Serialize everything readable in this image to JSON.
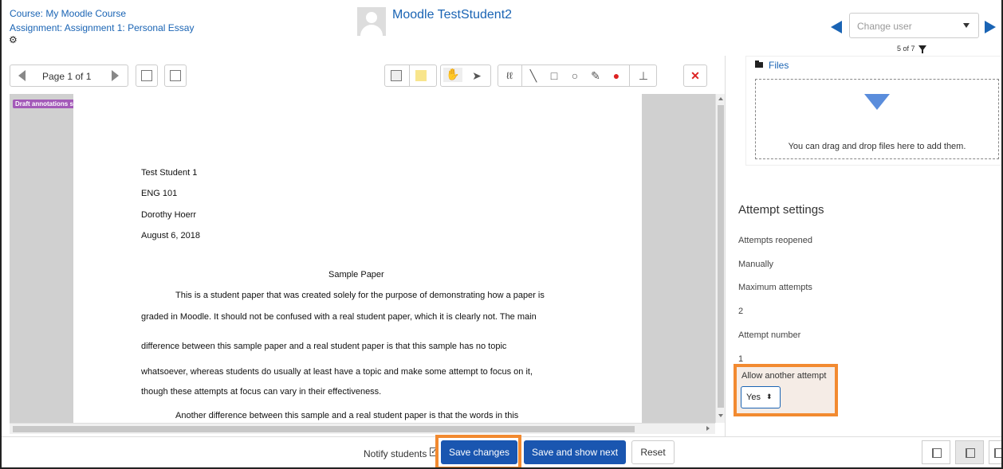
{
  "header": {
    "course_link": "Course: My Moodle Course",
    "assignment_link": "Assignment: Assignment 1: Personal Essay",
    "user_name": "Moodle TestStudent2",
    "change_user_placeholder": "Change user",
    "user_count": "5 of 7"
  },
  "toolbar": {
    "page_label": "Page 1 of 1"
  },
  "document": {
    "draft_badge": "Draft annotations saved",
    "lines": [
      "Test Student 1",
      "ENG 101",
      "Dorothy Hoerr",
      "August 6, 2018",
      "Sample Paper",
      "This is a student paper that was created solely for the purpose of demonstrating how a paper is",
      "graded in Moodle. It should not be confused with a real student paper, which it is clearly not. The main",
      "difference between this sample paper and a real student paper is that this sample has no topic",
      "whatsoever, whereas students do usually at least have a topic and make some attempt to focus on it,",
      "though these attempts at focus can vary in their effectiveness.",
      "Another difference between this sample and a real student paper is that the words in this"
    ]
  },
  "files": {
    "link": "Files",
    "drop_text": "You can drag and drop files here to add them."
  },
  "attempt_settings": {
    "heading": "Attempt settings",
    "reopened_label": "Attempts reopened",
    "reopened_value": "Manually",
    "max_label": "Maximum attempts",
    "max_value": "2",
    "number_label": "Attempt number",
    "number_value": "1",
    "allow_label": "Allow another attempt",
    "allow_value": "Yes"
  },
  "footer": {
    "notify_label": "Notify students",
    "save_label": "Save changes",
    "save_next_label": "Save and show next",
    "reset_label": "Reset"
  },
  "colors": {
    "link": "#1a64b4",
    "primary_button": "#1a56b0",
    "highlight": "#f28a30",
    "draft_badge": "#a35ab8"
  }
}
